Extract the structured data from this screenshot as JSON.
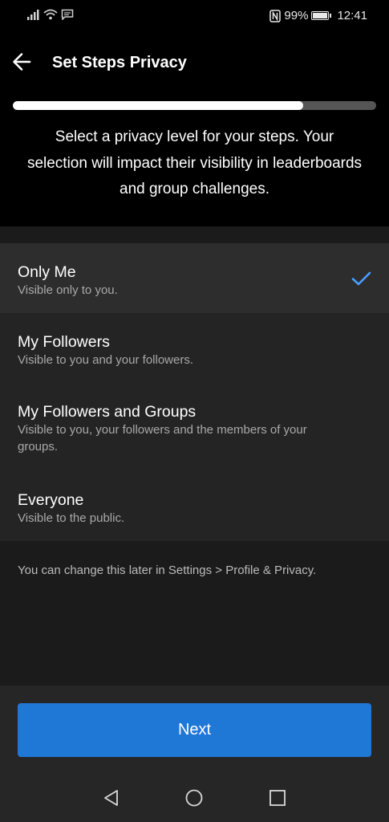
{
  "status_bar": {
    "battery_percent": "99%",
    "time": "12:41",
    "icons": [
      "signal-icon",
      "wifi-icon",
      "message-icon",
      "nfc-icon",
      "battery-icon"
    ]
  },
  "header": {
    "title": "Set Steps Privacy",
    "back_icon": "arrow-left-icon"
  },
  "progress": {
    "value": 0.8
  },
  "intro_text": "Select a privacy level for your steps. Your selection will impact their visibility in leaderboards and group challenges.",
  "options": [
    {
      "title": "Only Me",
      "description": "Visible only to you.",
      "selected": true
    },
    {
      "title": "My Followers",
      "description": "Visible to you and your followers.",
      "selected": false
    },
    {
      "title": "My Followers and Groups",
      "description": "Visible to you, your followers and the members of your groups.",
      "selected": false
    },
    {
      "title": "Everyone",
      "description": "Visible to the public.",
      "selected": false
    }
  ],
  "footnote": "You can change this later in Settings > Profile & Privacy.",
  "next_button": {
    "label": "Next"
  },
  "colors": {
    "accent": "#1f77d6",
    "check": "#4a9eff",
    "background": "#000000",
    "panel": "#1b1b1b"
  },
  "nav_bar": [
    "back-triangle-icon",
    "home-circle-icon",
    "recent-square-icon"
  ]
}
